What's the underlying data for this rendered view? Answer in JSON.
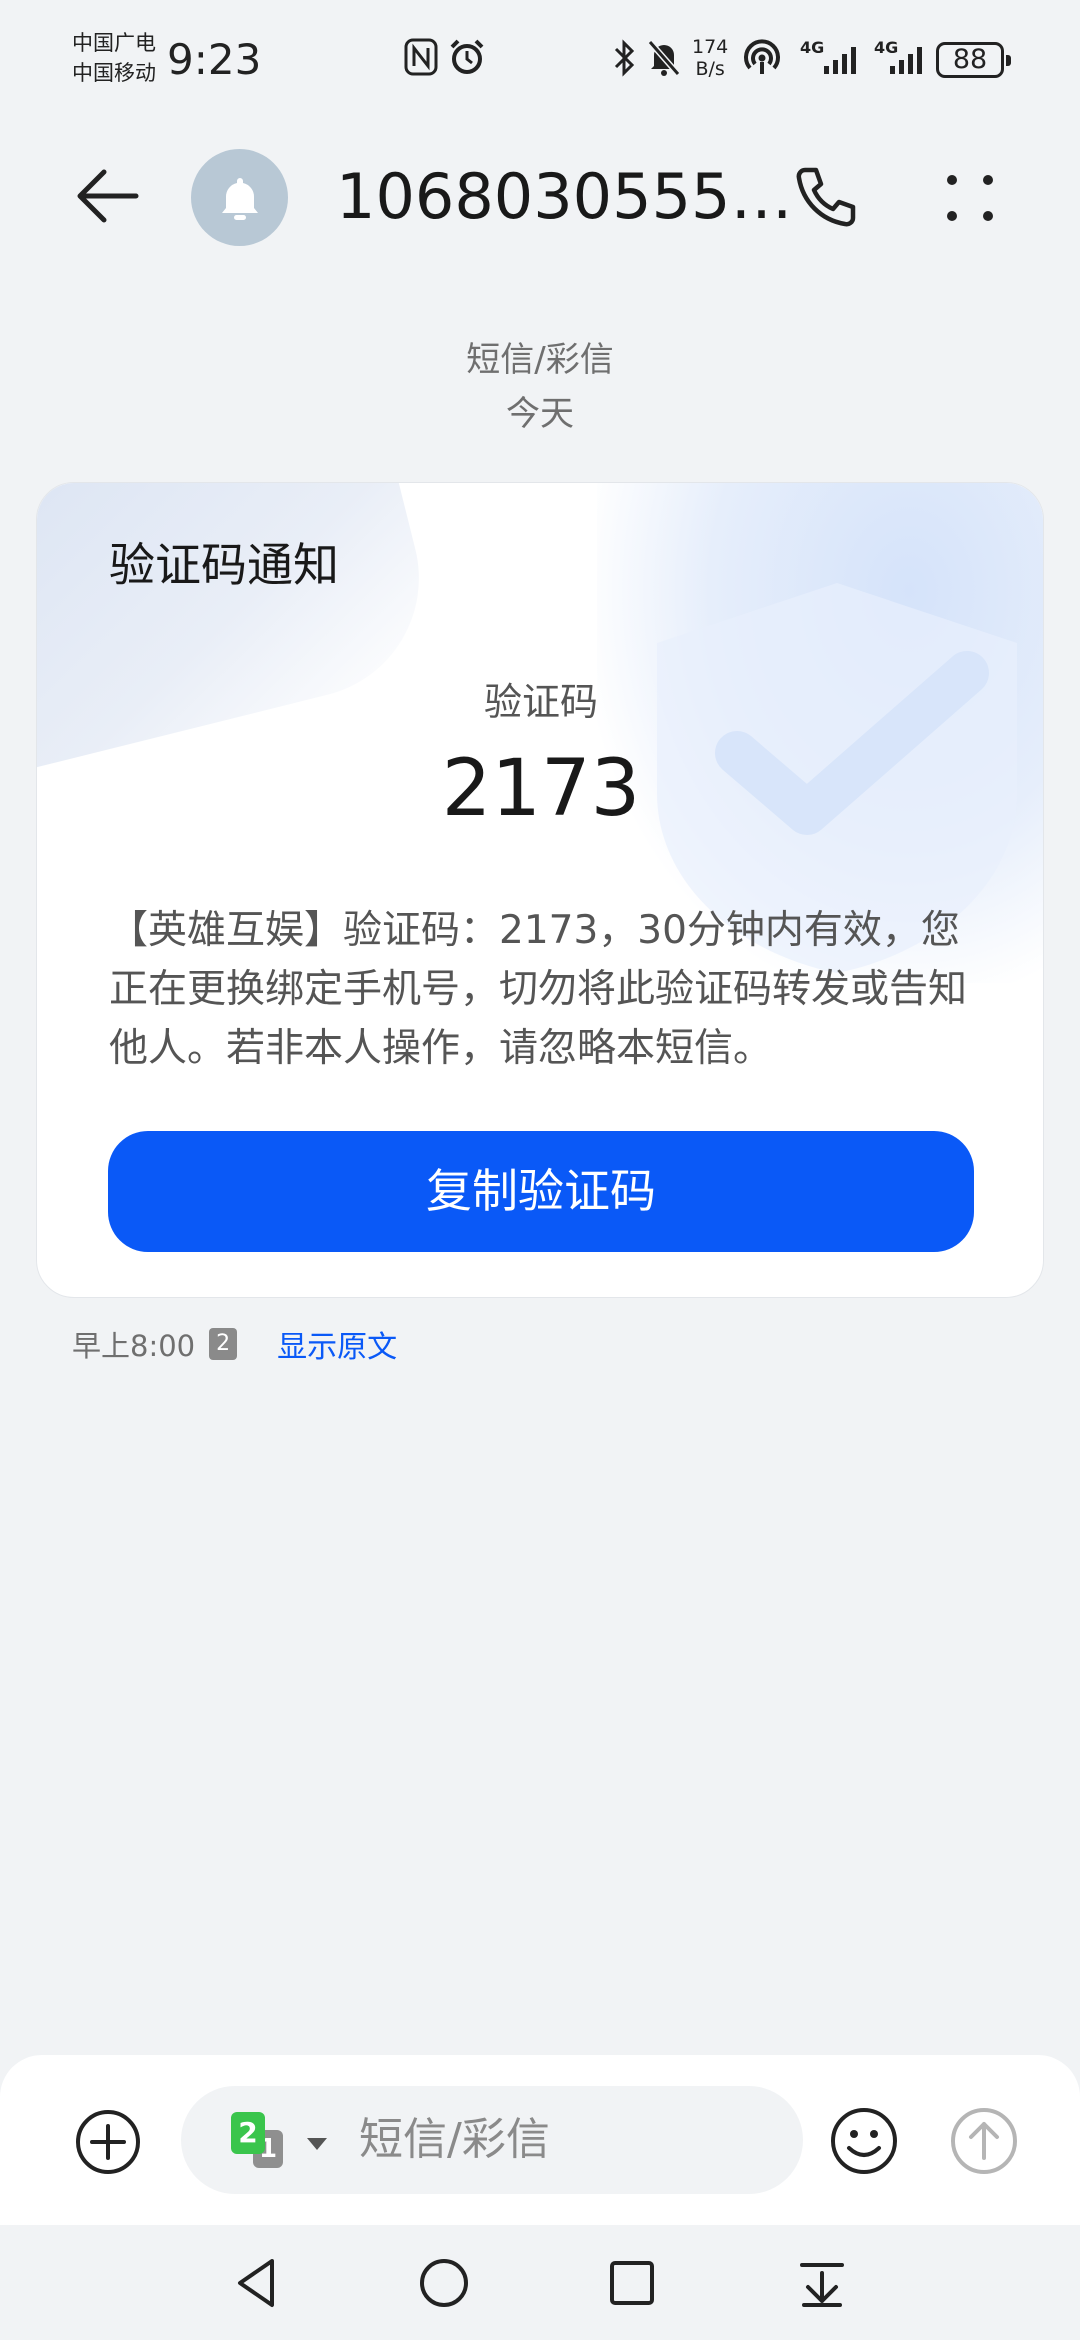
{
  "status_bar": {
    "carrier_1": "中国广电",
    "carrier_2": "中国移动",
    "time": "9:23",
    "net_speed_value": "174",
    "net_speed_unit": "B/s",
    "sim1_network": "4G",
    "sim2_network": "4G",
    "battery": "88",
    "icons": [
      "nfc-icon",
      "alarm-icon",
      "bluetooth-icon",
      "mute-icon",
      "hotspot-icon",
      "signal-icon"
    ]
  },
  "header": {
    "contact": "1068030555…",
    "avatar_icon": "bell-icon"
  },
  "thread": {
    "category": "短信/彩信",
    "date": "今天"
  },
  "card": {
    "title": "验证码通知",
    "code_label": "验证码",
    "code": "2173",
    "body": "【英雄互娱】验证码：2173，30分钟内有效，您正在更换绑定手机号，切勿将此验证码转发或告知他人。若非本人操作，请忽略本短信。",
    "copy_button": "复制验证码"
  },
  "message_meta": {
    "time": "早上8:00",
    "sim_slot": "2",
    "show_original": "显示原文"
  },
  "composer": {
    "sim_primary": "2",
    "sim_secondary": "1",
    "placeholder": "短信/彩信"
  },
  "colors": {
    "accent": "#0a59f7",
    "background": "#f1f3f5",
    "sim_green": "#3ac54c"
  }
}
